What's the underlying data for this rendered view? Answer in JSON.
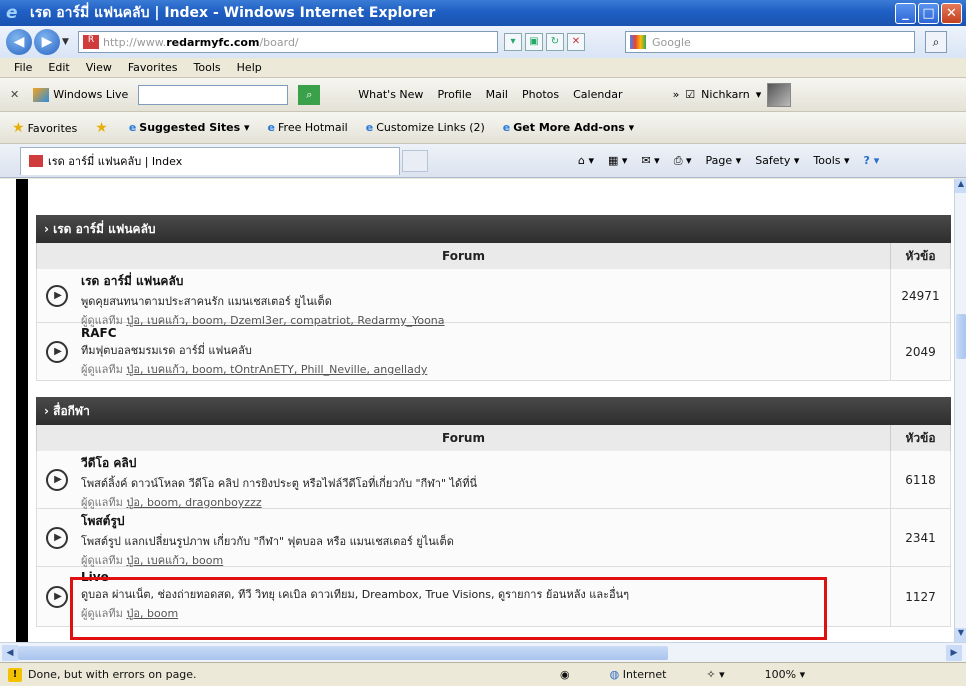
{
  "window": {
    "title": "เรด อาร์มี่ แฟนคลับ | Index - Windows Internet Explorer"
  },
  "address": {
    "url_prefix": "http://www.",
    "url_domain": "redarmyfc.com",
    "url_path": "/board/"
  },
  "search": {
    "placeholder": "Google"
  },
  "menu": [
    "File",
    "Edit",
    "View",
    "Favorites",
    "Tools",
    "Help"
  ],
  "live": {
    "label": "Windows Live",
    "links": [
      "What's New",
      "Profile",
      "Mail",
      "Photos",
      "Calendar"
    ],
    "user": "Nichkarn"
  },
  "favorites": {
    "label": "Favorites",
    "items": [
      "Suggested Sites",
      "Free Hotmail",
      "Customize Links (2)",
      "Get More Add-ons"
    ]
  },
  "tab": {
    "title": "เรด อาร์มี่ แฟนคลับ | Index"
  },
  "commands": [
    "Page",
    "Safety",
    "Tools"
  ],
  "sections": [
    {
      "title": "› เรด อาร์มี่ แฟนคลับ",
      "header": {
        "forum": "Forum",
        "topics": "หัวข้อ"
      },
      "rows": [
        {
          "title": "เรด อาร์มี่ แฟนคลับ",
          "desc": "พูดคุยสนทนาตามประสาคนรัก แมนเชสเตอร์ ยูไนเต็ด",
          "mods_label": "ผู้ดูแลทีม",
          "mods": "ปู่อ, เบคแก้ว, boom, Dzeml3er, compatriot, Redarmy_Yoona",
          "count": "24971"
        },
        {
          "title": "RAFC",
          "desc": "ทีมฟุตบอลชมรมเรด อาร์มี่ แฟนคลับ",
          "mods_label": "ผู้ดูแลทีม",
          "mods": "ปู่อ, เบคแก้ว, boom, tOntrAnETY, Phill_Neville, angellady",
          "count": "2049"
        }
      ]
    },
    {
      "title": "› สื่อกีฬา",
      "header": {
        "forum": "Forum",
        "topics": "หัวข้อ"
      },
      "rows": [
        {
          "title": "วีดีโอ คลิป",
          "desc": "โพสต์ลิ้งค์ ดาวน์โหลด วีดีโอ คลิป การยิงประตู หรือไฟล์วีดีโอที่เกี่ยวกับ \"กีฬา\" ได้ที่นี่",
          "mods_label": "ผู้ดูแลทีม",
          "mods": "ปู่อ, boom, dragonboyzzz",
          "count": "6118"
        },
        {
          "title": "โพสต์รูป",
          "desc": "โพสต์รูป แลกเปลี่ยนรูปภาพ เกี่ยวกับ \"กีฬา\" ฟุตบอล หรือ แมนเชสเตอร์ ยูไนเต็ด",
          "mods_label": "ผู้ดูแลทีม",
          "mods": "ปู่อ, เบคแก้ว, boom",
          "count": "2341"
        },
        {
          "title": "Live",
          "desc": "ดูบอล ผ่านเน็ต, ช่องถ่ายทอดสด, ทีวี วิทยุ เคเบิล ดาวเทียม, Dreambox, True Visions, ดูรายการ ย้อนหลัง และอื่นๆ",
          "mods_label": "ผู้ดูแลทีม",
          "mods": "ปู่อ, boom",
          "count": "1127"
        }
      ]
    }
  ],
  "status": {
    "text": "Done, but with errors on page.",
    "zone": "Internet",
    "zoom": "100%"
  },
  "colors": {
    "highlight": "#e01010",
    "section_bg": "#3a3a3a",
    "titlebar": "#1f5fc4"
  }
}
